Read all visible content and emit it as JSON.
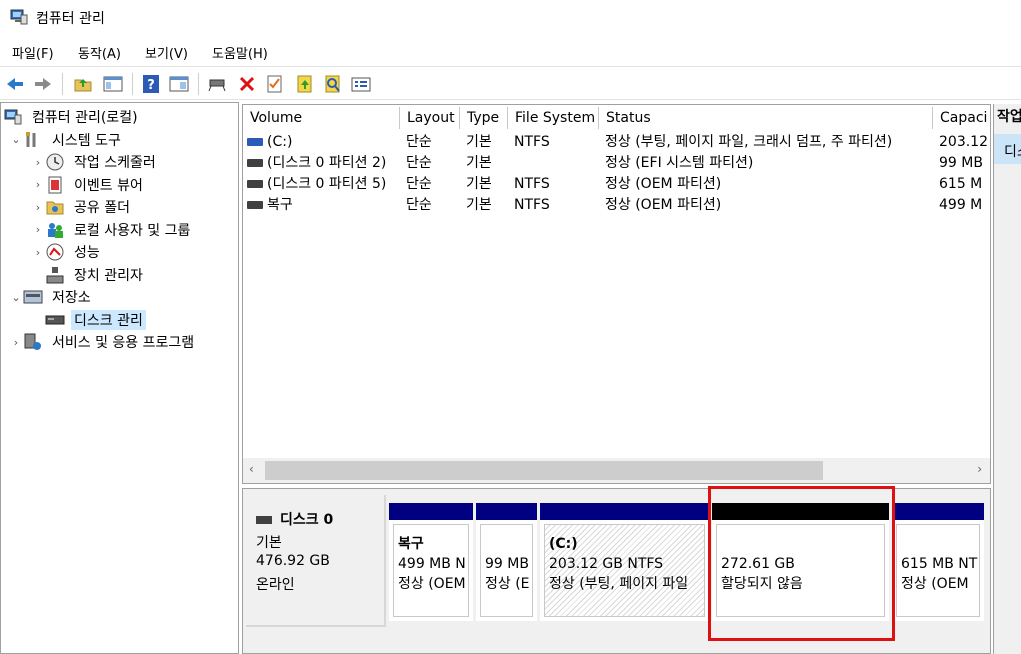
{
  "window": {
    "title": "컴퓨터 관리",
    "icon": "computer-management-icon"
  },
  "menu": [
    {
      "label": "파일(F)",
      "name": "menu-file"
    },
    {
      "label": "동작(A)",
      "name": "menu-action"
    },
    {
      "label": "보기(V)",
      "name": "menu-view"
    },
    {
      "label": "도움말(H)",
      "name": "menu-help"
    }
  ],
  "toolbar": [
    "back-icon",
    "forward-icon",
    "up-folder-icon",
    "show-hide-tree-icon",
    "help-icon",
    "properties-pane-icon",
    "connect-drive-icon",
    "delete-icon",
    "checklist-icon",
    "import-icon",
    "search-icon",
    "properties-icon"
  ],
  "tree": [
    {
      "label": "컴퓨터 관리(로컬)",
      "icon": "computer-management-icon",
      "level": 0,
      "chev": "",
      "name": "tree-root"
    },
    {
      "label": "시스템 도구",
      "icon": "tools-icon",
      "level": 1,
      "chev": "⌄",
      "name": "tree-system-tools"
    },
    {
      "label": "작업 스케줄러",
      "icon": "clock-icon",
      "level": 2,
      "chev": "›",
      "name": "tree-task-scheduler"
    },
    {
      "label": "이벤트 뷰어",
      "icon": "event-viewer-icon",
      "level": 2,
      "chev": "›",
      "name": "tree-event-viewer"
    },
    {
      "label": "공유 폴더",
      "icon": "shared-folder-icon",
      "level": 2,
      "chev": "›",
      "name": "tree-shared-folders"
    },
    {
      "label": "로컬 사용자 및 그룹",
      "icon": "users-icon",
      "level": 2,
      "chev": "›",
      "name": "tree-local-users"
    },
    {
      "label": "성능",
      "icon": "performance-icon",
      "level": 2,
      "chev": "›",
      "name": "tree-performance"
    },
    {
      "label": "장치 관리자",
      "icon": "device-manager-icon",
      "level": 2,
      "chev": "",
      "name": "tree-device-manager"
    },
    {
      "label": "저장소",
      "icon": "storage-icon",
      "level": 1,
      "chev": "⌄",
      "name": "tree-storage"
    },
    {
      "label": "디스크 관리",
      "icon": "disk-icon",
      "level": 2,
      "chev": "",
      "name": "tree-disk-management",
      "selected": true
    },
    {
      "label": "서비스 및 응용 프로그램",
      "icon": "services-icon",
      "level": 1,
      "chev": "›",
      "name": "tree-services"
    }
  ],
  "volumes": {
    "columns": [
      {
        "label": "Volume",
        "w": 157
      },
      {
        "label": "Layout",
        "w": 60
      },
      {
        "label": "Type",
        "w": 48
      },
      {
        "label": "File System",
        "w": 91
      },
      {
        "label": "Status",
        "w": 334
      },
      {
        "label": "Capaci",
        "w": 59
      }
    ],
    "rows": [
      {
        "cells": [
          "(C:)",
          "단순",
          "기본",
          "NTFS",
          "정상 (부팅, 페이지 파일, 크래시 덤프, 주 파티션)",
          "203.12"
        ],
        "color": "#2b5bb5"
      },
      {
        "cells": [
          "(디스크 0 파티션 2)",
          "단순",
          "기본",
          "",
          "정상 (EFI 시스템 파티션)",
          "99 MB"
        ],
        "color": "#404040"
      },
      {
        "cells": [
          "(디스크 0 파티션 5)",
          "단순",
          "기본",
          "NTFS",
          "정상 (OEM 파티션)",
          "615 M"
        ],
        "color": "#404040"
      },
      {
        "cells": [
          "복구",
          "단순",
          "기본",
          "NTFS",
          "정상 (OEM 파티션)",
          "499 M"
        ],
        "color": "#404040"
      }
    ]
  },
  "disk": {
    "name": "디스크 0",
    "type": "기본",
    "size": "476.92 GB",
    "status": "온라인",
    "partitions": [
      {
        "title": "복구",
        "line1": "499 MB N",
        "line2": "정상 (OEM",
        "bar": "#000080",
        "hatch": false
      },
      {
        "title": "",
        "line1": "99 MB",
        "line2": "정상 (E",
        "bar": "#000080",
        "hatch": false
      },
      {
        "title": "(C:)",
        "line1": "203.12 GB NTFS",
        "line2": "정상 (부팅, 페이지 파일",
        "bar": "#000080",
        "hatch": true
      },
      {
        "title": "",
        "line1": "272.61 GB",
        "line2": "할당되지 않음",
        "bar": "#000000",
        "hatch": false
      },
      {
        "title": "",
        "line1": "615 MB NT",
        "line2": "정상 (OEM",
        "bar": "#000080",
        "hatch": false
      }
    ]
  },
  "actions": {
    "header": "작업",
    "item": "디스"
  }
}
